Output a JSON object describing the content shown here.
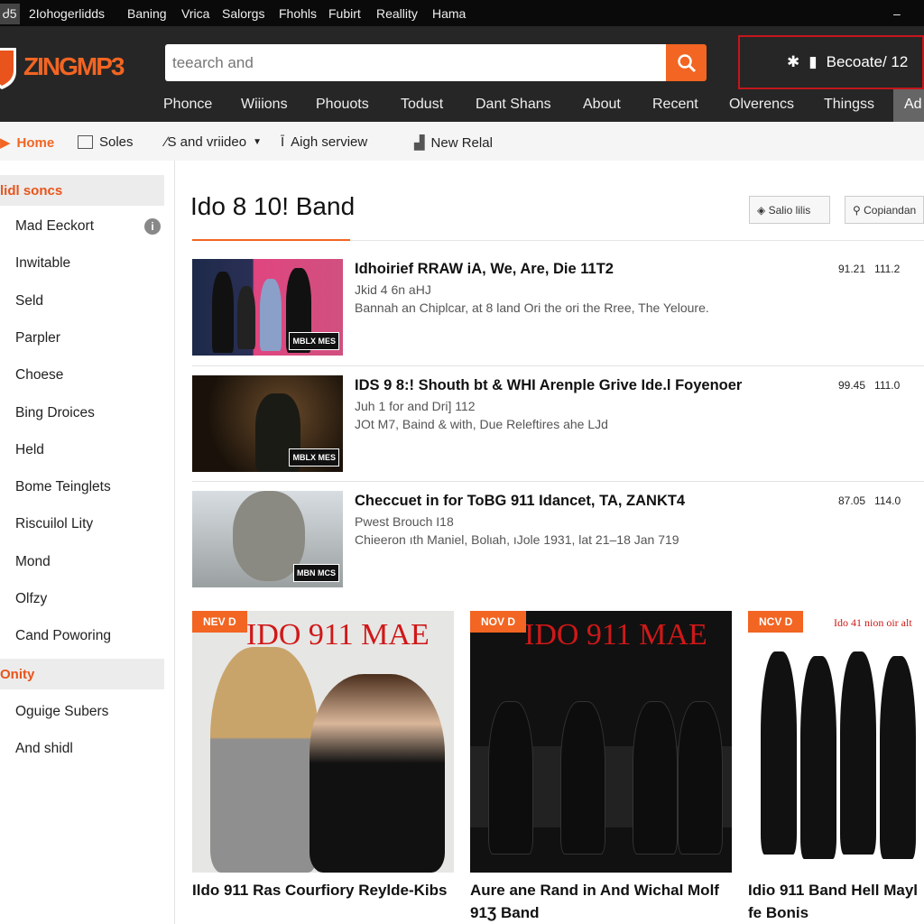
{
  "topbar": {
    "items": [
      "Ꮷ5",
      "2Іohogerlidds",
      "Baning",
      "Vrica",
      "Salorgs",
      "Fhohls",
      "Fubirt",
      "Reallity",
      "Hama"
    ],
    "minimize": "–"
  },
  "header": {
    "logo": "ZINGMP3",
    "search_placeholder": "teearch and",
    "user_label": "Becoate/ 12",
    "nav": [
      "Phonce",
      "Wiiions",
      "Phouots",
      "Todust",
      "Dant Shans",
      "About",
      "Recent",
      "Olverencs",
      "Thingss",
      "Ad"
    ]
  },
  "subnav": {
    "items": [
      "Home",
      "Soles",
      "∕S and vriideo",
      "Aigh serview",
      "New Relal"
    ]
  },
  "sidebar": {
    "sections": [
      {
        "title": "lidl soncs",
        "items": [
          "Mad Eeckort",
          "Inwitable",
          "Seld",
          "Parpler",
          "Choese",
          "Bing Droices",
          "Held",
          "Bome Teinglets",
          "Riscuilol Lity",
          "Mond",
          "Olfzy",
          "Cand Poworing"
        ]
      },
      {
        "title": "Onity",
        "items": [
          "Oguige Subers",
          "And shidl"
        ]
      }
    ]
  },
  "main": {
    "title": "Ido 8 10! Band",
    "buttons": [
      "Salio lilis",
      "Copiandan"
    ],
    "rows": [
      {
        "title": "Idhoirief RRAW iA, We, Are, Die 11T2",
        "sub": "Jkid 4 6n aHJ",
        "desc": "Bannah an Chiplcar, at 8 land Ori the ori the Rree, The Yeloure.",
        "nums": "91.21   111.2",
        "badge": "MBLX MES"
      },
      {
        "title": "IDS 9 8:! Shouth bt & WHI Arenple Grive Ide.l Foyenoer",
        "sub": "Juh 1 for and Dri] 112",
        "desc": "JOt M7, Baind & with, Due Releftires ahe LJd",
        "nums": "99.45   111.0",
        "badge": "MBLX MES"
      },
      {
        "title": "Checcuet in for ToBG 911 Idancet, TA, ZANKT4",
        "sub": "Pwest Brouch I18",
        "desc": "Chieeron ıth Maniel, Bolιah, ıJole 1931, lat 21–18 Jan 719",
        "nums": "87.05   114.0",
        "badge": "MBN MCS"
      }
    ],
    "cards": [
      {
        "badge": "NEV D",
        "art": "IDO 911 MAE",
        "title": "Ildo 911 Ras Courfiory Reylde-Kibs"
      },
      {
        "badge": "NOV D",
        "art": "IDO 911 MAE",
        "title": "Aure ane Rand in And Wichal Molf 91Ʒ Band"
      },
      {
        "badge": "NCV D",
        "art": "Ido 41 nion oir alt",
        "title": "Idio 911 Band Hell Mayl fe Bonis"
      }
    ]
  },
  "colors": {
    "accent": "#f26522",
    "header": "#262626",
    "topbar": "#0a0a0a",
    "highlight_border": "#c4161c"
  }
}
